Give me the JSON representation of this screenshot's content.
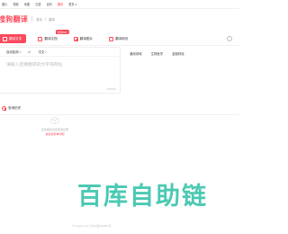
{
  "topnav": {
    "items": [
      "图片",
      "视频",
      "地图",
      "汉语",
      "百科",
      "翻译",
      "更多"
    ],
    "active_index": 5
  },
  "header": {
    "logo_text": "搜狗翻译",
    "breadcrumb": [
      "首页",
      "翻译"
    ]
  },
  "tabs": [
    {
      "label": "翻译文字",
      "icon": "text-icon"
    },
    {
      "label": "翻译文档",
      "icon": "document-icon",
      "badge": "支持PDF"
    },
    {
      "label": "翻译图片",
      "icon": "image-icon"
    },
    {
      "label": "翻译网页",
      "icon": "web-icon"
    }
  ],
  "translator": {
    "source_lang": "自动检测",
    "target_lang": "中文",
    "swap_symbol": "⇄",
    "placeholder": "请输入您要翻译的文字或网址",
    "counter": "0/5000"
  },
  "options": [
    "通用领域",
    "生物医学",
    "金融财经"
  ],
  "history": {
    "title": "查询历史",
    "empty_text": "您目前还没有查询记录",
    "empty_link": "快来搜索单词吧"
  },
  "watermark": "百库自助链",
  "footer": "© Sogou.com  京ICP证050897号",
  "colors": {
    "accent": "#fc4a5c",
    "watermark": "#2cbfa4"
  }
}
